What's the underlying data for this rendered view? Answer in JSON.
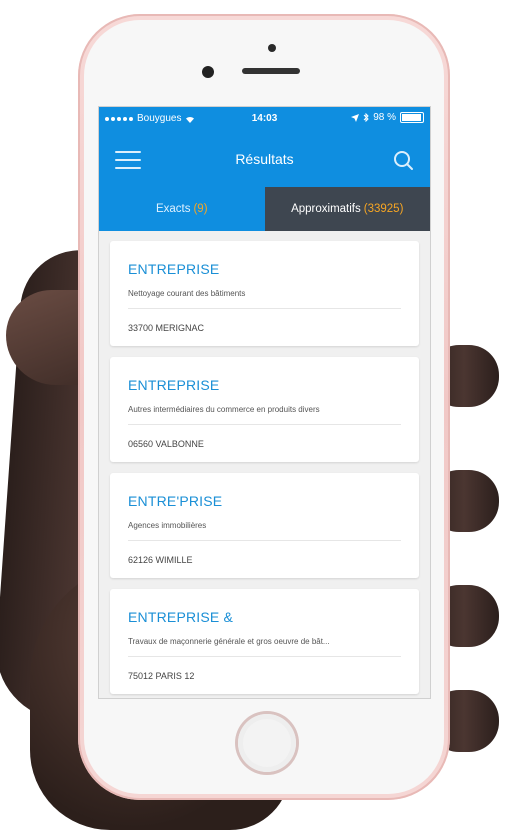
{
  "status_bar": {
    "carrier": "Bouygues",
    "time": "14:03",
    "battery": "98 %"
  },
  "nav": {
    "title": "Résultats"
  },
  "tabs": [
    {
      "label": "Exacts",
      "count": "(9)"
    },
    {
      "label": "Approximatifs",
      "count": "(33925)"
    }
  ],
  "results": [
    {
      "name": "ENTREPRISE",
      "activity": "Nettoyage courant des bâtiments",
      "city": "33700 MERIGNAC"
    },
    {
      "name": "ENTREPRISE",
      "activity": "Autres intermédiaires du commerce en produits divers",
      "city": "06560 VALBONNE"
    },
    {
      "name": "ENTRE'PRISE",
      "activity": "Agences immobilières",
      "city": "62126 WIMILLE"
    },
    {
      "name": "ENTREPRISE &",
      "activity": "Travaux de maçonnerie générale et gros oeuvre de bât...",
      "city": "75012 PARIS 12"
    }
  ],
  "colors": {
    "accent": "#0f8ee0",
    "tab_dark": "#3e4650",
    "count_orange": "#f7a623",
    "phone_rose_gold": "#f1c8c6"
  }
}
